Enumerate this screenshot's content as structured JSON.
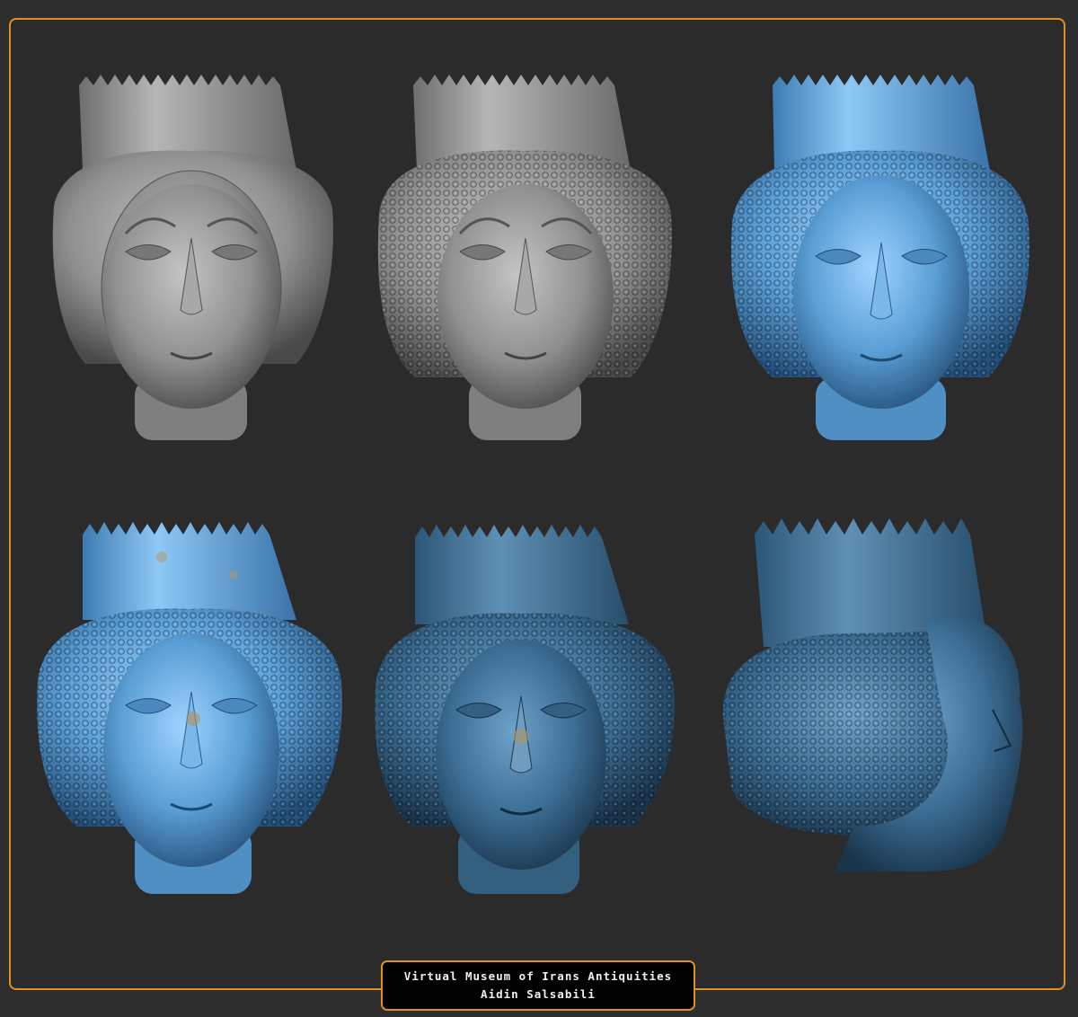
{
  "image": {
    "description_visible": false,
    "panels": [
      {
        "id": "head-1",
        "render": "clay-grey-no-hair"
      },
      {
        "id": "head-2",
        "render": "clay-grey-detailed"
      },
      {
        "id": "head-3",
        "render": "blue-matcap"
      },
      {
        "id": "head-4",
        "render": "blue-weathered"
      },
      {
        "id": "head-5",
        "render": "dark-blue-weathered"
      },
      {
        "id": "head-6",
        "render": "blue-profile"
      }
    ]
  },
  "colors": {
    "background": "#2e2e2e",
    "frame_border": "#e0901e",
    "clay": "#8f8f8f",
    "blue": "#5a9fd6",
    "dark_blue": "#3d6f96"
  },
  "caption": {
    "line1": "Virtual Museum of Irans Antiquities",
    "line2": "Aidin Salsabili"
  }
}
